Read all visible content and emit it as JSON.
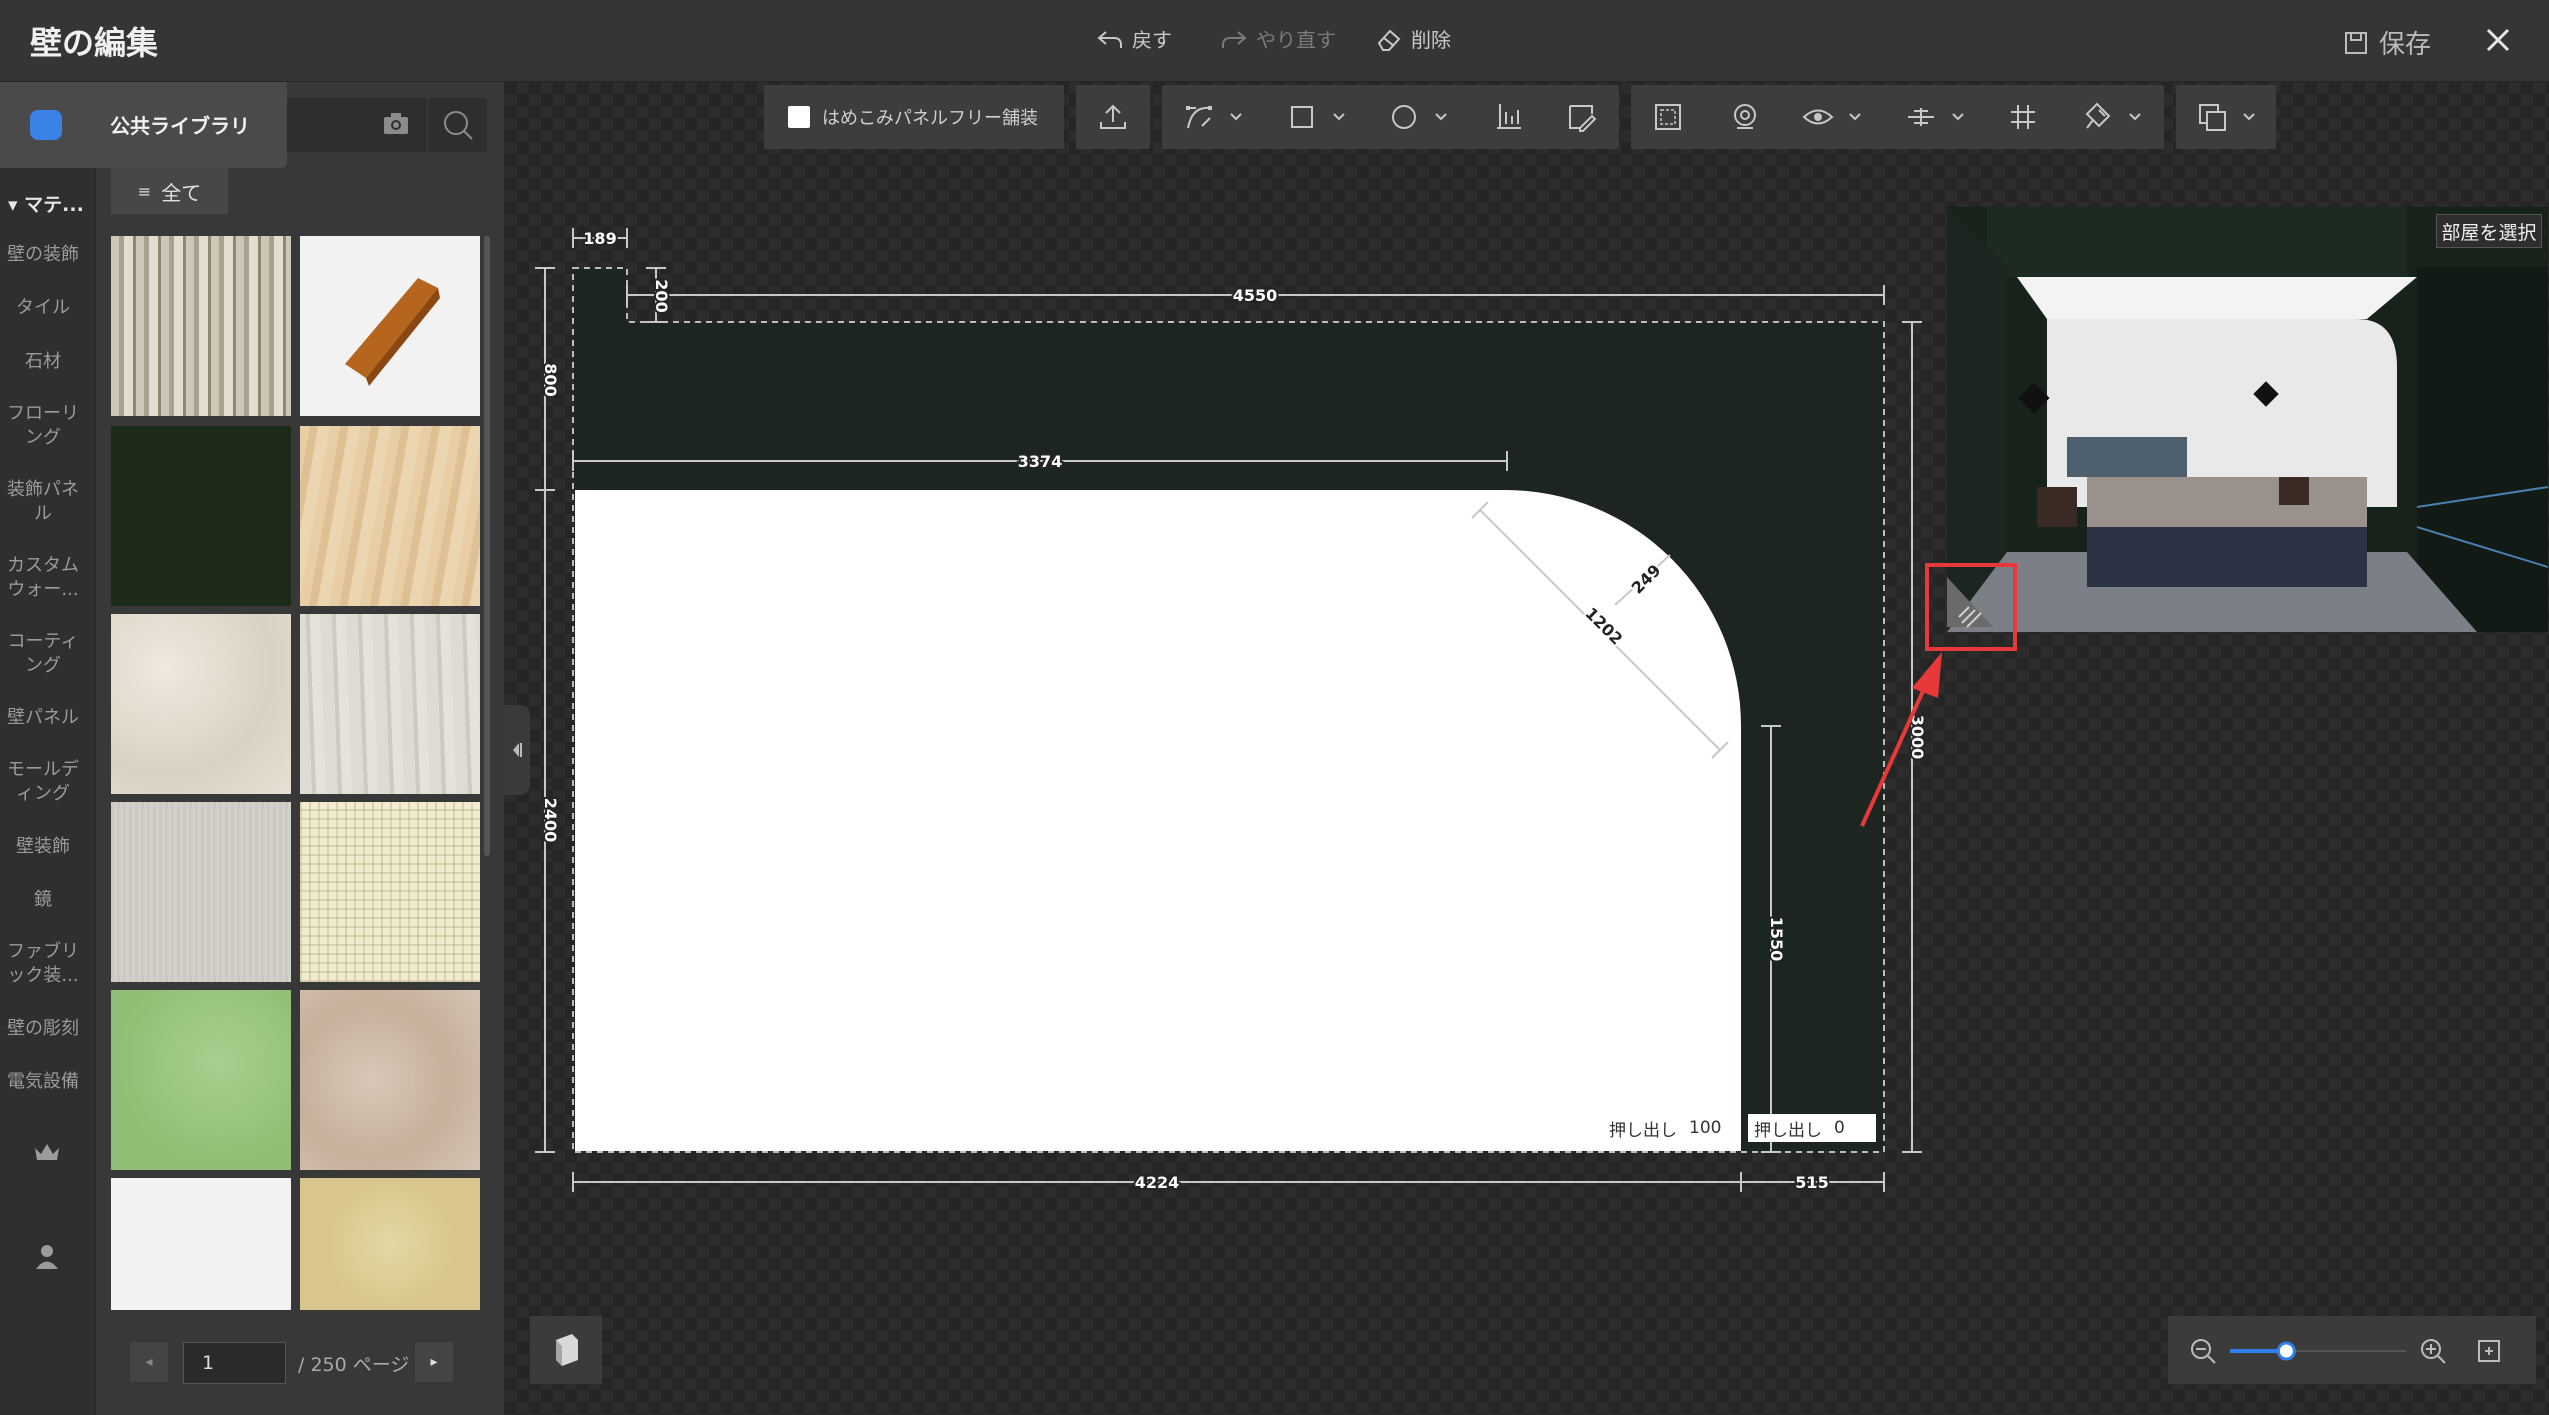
{
  "titlebar": {
    "title": "壁の編集",
    "undo_label": "戻す",
    "redo_label": "やり直す",
    "delete_label": "削除",
    "save_label": "保存"
  },
  "library": {
    "tab_label": "公共ライブラリ",
    "all_label": "全て",
    "category_header": "マテ...",
    "categories": [
      "壁の装飾",
      "タイル",
      "石材",
      "フローリング",
      "装飾パネル",
      "カスタムウォー...",
      "コーティング",
      "壁パネル",
      "モールディング",
      "壁装飾",
      "鏡",
      "ファブリック装...",
      "壁の彫刻",
      "電気設備"
    ]
  },
  "pagination": {
    "current": "1",
    "total_label": "/ 250 ページ"
  },
  "toolbar": {
    "panel_free_label": "はめこみパネルフリー舗装"
  },
  "dimensions": {
    "d189": "189",
    "d200": "200",
    "d4550": "4550",
    "d800": "800",
    "d3374": "3374",
    "d249": "249",
    "d1202": "1202",
    "d2400": "2400",
    "d3000": "3000",
    "d1550": "1550",
    "d4224": "4224",
    "d515": "515"
  },
  "extrude": {
    "label": "押し出し",
    "value_left": "100",
    "value_right": "0"
  },
  "preview": {
    "room_select_label": "部屋を選択"
  },
  "zoom": {
    "level": 0.32
  },
  "colors": {
    "wall": "#1c2520",
    "accent": "#2f80ed",
    "highlight": "#e8393a"
  }
}
